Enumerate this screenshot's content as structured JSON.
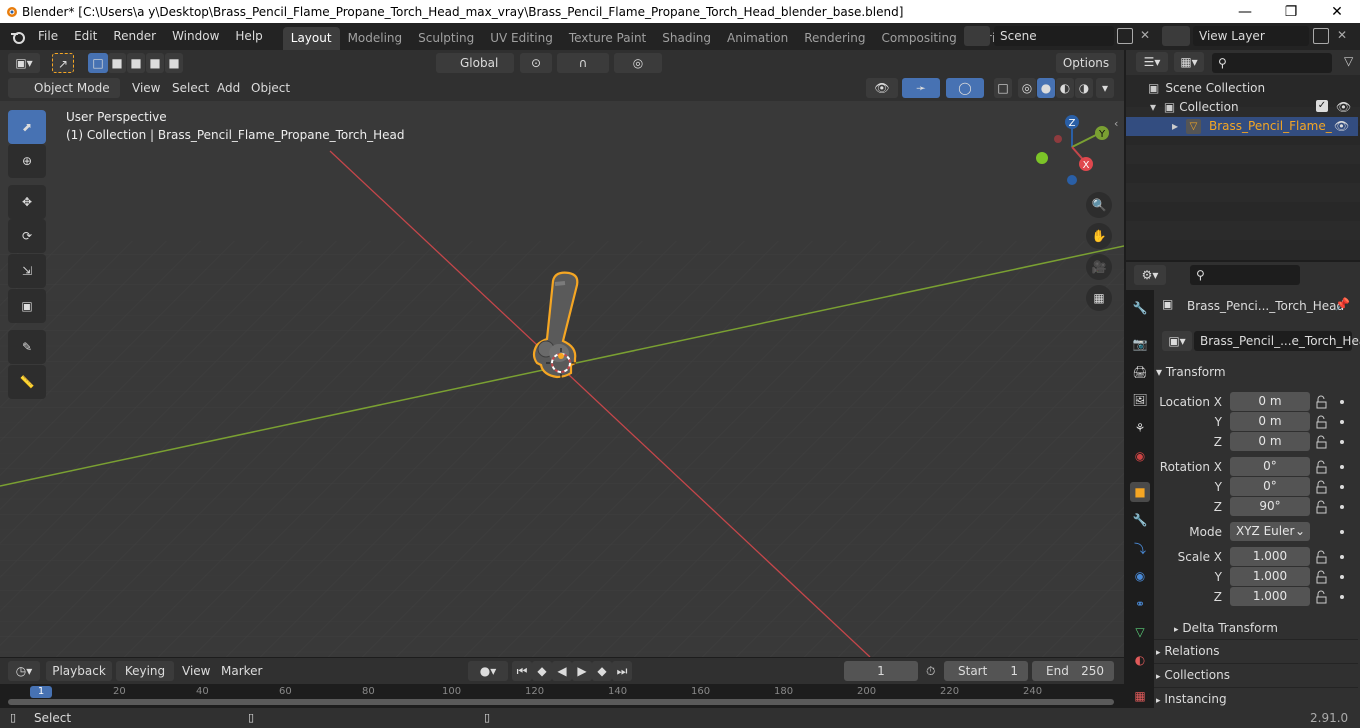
{
  "window": {
    "title": "Blender* [C:\\Users\\a y\\Desktop\\Brass_Pencil_Flame_Propane_Torch_Head_max_vray\\Brass_Pencil_Flame_Propane_Torch_Head_blender_base.blend]"
  },
  "menus": [
    "File",
    "Edit",
    "Render",
    "Window",
    "Help"
  ],
  "workspaces": [
    "Layout",
    "Modeling",
    "Sculpting",
    "UV Editing",
    "Texture Paint",
    "Shading",
    "Animation",
    "Rendering",
    "Compositing",
    "Scripting"
  ],
  "active_workspace": "Layout",
  "scene": {
    "name": "Scene"
  },
  "view_layer": {
    "name": "View Layer"
  },
  "toolhdr": {
    "orientation": "Global",
    "options": "Options"
  },
  "vphdr": {
    "mode": "Object Mode",
    "view": "View",
    "select": "Select",
    "add": "Add",
    "object": "Object"
  },
  "viewport": {
    "perspective": "User Perspective",
    "collection_info": "(1) Collection | Brass_Pencil_Flame_Propane_Torch_Head",
    "gizmo": {
      "x": "X",
      "y": "Y",
      "z": "Z"
    }
  },
  "outliner": {
    "scene_collection": "Scene Collection",
    "collection": "Collection",
    "object": "Brass_Pencil_Flame_"
  },
  "properties": {
    "object_name": "Brass_Penci..._Torch_Head",
    "data_name": "Brass_Pencil_...e_Torch_Head",
    "transform_label": "Transform",
    "location_x_label": "Location X",
    "location_y_label": "Y",
    "location_z_label": "Z",
    "location_x": "0 m",
    "location_y": "0 m",
    "location_z": "0 m",
    "rotation_x_label": "Rotation X",
    "rotation_y_label": "Y",
    "rotation_z_label": "Z",
    "rotation_x": "0°",
    "rotation_y": "0°",
    "rotation_z": "90°",
    "mode_label": "Mode",
    "mode_value": "XYZ Euler",
    "scale_x_label": "Scale X",
    "scale_y_label": "Y",
    "scale_z_label": "Z",
    "scale_x": "1.000",
    "scale_y": "1.000",
    "scale_z": "1.000",
    "delta_transform": "Delta Transform",
    "relations": "Relations",
    "collections": "Collections",
    "instancing": "Instancing"
  },
  "timeline": {
    "playback": "Playback",
    "keying": "Keying",
    "view": "View",
    "marker": "Marker",
    "current_frame": "1",
    "start_label": "Start",
    "start_value": "1",
    "end_label": "End",
    "end_value": "250",
    "ruler": [
      "1",
      "20",
      "40",
      "60",
      "80",
      "100",
      "120",
      "140",
      "160",
      "180",
      "200",
      "220",
      "240"
    ]
  },
  "statusbar": {
    "select": "Select",
    "version": "2.91.0"
  },
  "colors": {
    "selection": "#f5a623",
    "x_axis": "#c4464a",
    "y_axis": "#7aa032",
    "active_blue": "#4772b3"
  }
}
